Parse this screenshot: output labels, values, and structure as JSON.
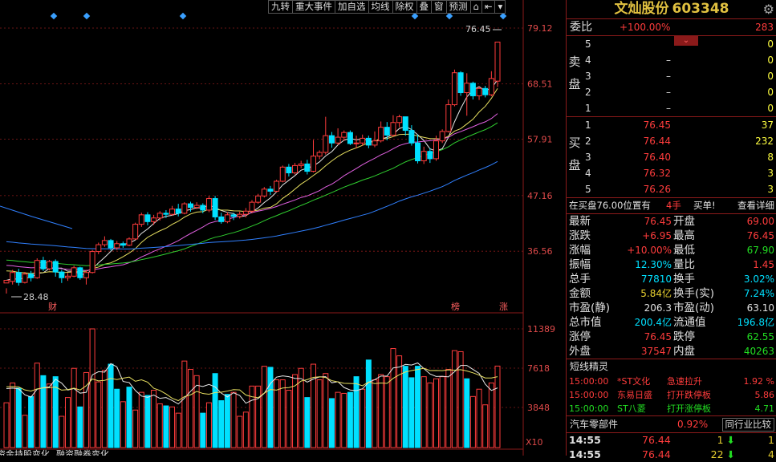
{
  "toolbar": [
    "九转",
    "重大事件",
    "加自选",
    "均线",
    "除权",
    "叠",
    "窗",
    "预测",
    "⇤",
    "▾"
  ],
  "axis": {
    "price_labels": [
      "79.12",
      "68.51",
      "57.91",
      "47.16",
      "36.56"
    ],
    "volume_labels": [
      "11389",
      "7618",
      "3848"
    ],
    "volume_unit": "X10"
  },
  "annotations": {
    "high_label": "76.45",
    "low_label": "28.48",
    "event_left": "财",
    "event_right1": "榜",
    "event_right2": "涨"
  },
  "bottom_tabs": [
    "资金持股变化",
    "融资融券变化"
  ],
  "stock": {
    "name": "文灿股份",
    "code": "603348"
  },
  "weibi": {
    "label": "委比",
    "pct": "+100.00%",
    "val": "283"
  },
  "sell": {
    "label": "卖盘",
    "rows": [
      {
        "n": "5",
        "p": "",
        "v": "0"
      },
      {
        "n": "4",
        "p": "–",
        "v": "0"
      },
      {
        "n": "3",
        "p": "–",
        "v": "0"
      },
      {
        "n": "2",
        "p": "–",
        "v": "0"
      },
      {
        "n": "1",
        "p": "–",
        "v": "0"
      }
    ]
  },
  "buy": {
    "label": "买盘",
    "rows": [
      {
        "n": "1",
        "p": "76.45",
        "v": "37"
      },
      {
        "n": "2",
        "p": "76.44",
        "v": "232"
      },
      {
        "n": "3",
        "p": "76.40",
        "v": "8"
      },
      {
        "n": "4",
        "p": "76.32",
        "v": "3"
      },
      {
        "n": "5",
        "p": "76.26",
        "v": "3"
      }
    ]
  },
  "pos_bar": {
    "text": "在买盘76.00位置有",
    "num": "4手",
    "action": "买单!",
    "detail": "查看详细"
  },
  "quote": [
    [
      "最新",
      "76.45",
      "开盘",
      "69.00"
    ],
    [
      "涨跌",
      "+6.95",
      "最高",
      "76.45"
    ],
    [
      "涨幅",
      "+10.00%",
      "最低",
      "67.90"
    ],
    [
      "振幅",
      "12.30%",
      "量比",
      "1.45"
    ],
    [
      "总手",
      "77810",
      "换手",
      "3.02%"
    ],
    [
      "金额",
      "5.84亿",
      "换手(实)",
      "7.24%"
    ],
    [
      "市盈(静)",
      "206.3",
      "市盈(动)",
      "63.10"
    ],
    [
      "总市值",
      "200.4亿",
      "流通值",
      "196.8亿"
    ],
    [
      "涨停",
      "76.45",
      "跌停",
      "62.55"
    ],
    [
      "外盘",
      "37547",
      "内盘",
      "40263"
    ]
  ],
  "spirit": {
    "title": "短线精灵",
    "rows": [
      [
        "15:00:00",
        "*ST文化",
        "急速拉升",
        "1.92 %"
      ],
      [
        "15:00:00",
        "东易日盛",
        "打开跌停板",
        "5.86"
      ],
      [
        "15:00:00",
        "ST八菱",
        "打开涨停板",
        "4.71"
      ]
    ]
  },
  "sector": {
    "name": "汽车零部件",
    "pct": "0.92%",
    "btn": "同行业比较"
  },
  "ticks": [
    [
      "14:55",
      "76.44",
      "1",
      "1"
    ],
    [
      "14:55",
      "76.44",
      "22",
      "4"
    ]
  ],
  "colors": {
    "up": "#ff3c3c",
    "down": "#00e0ff",
    "bg": "#000000",
    "grid": "#8b1a1a"
  },
  "chart_data": {
    "type": "candlestick",
    "ylim": [
      28.48,
      79.12
    ],
    "candles": [
      [
        30.5,
        31.0,
        29.5,
        28.48
      ],
      [
        30.8,
        32.5,
        30.2,
        33.0
      ],
      [
        32.5,
        30.6,
        30.0,
        33.2
      ],
      [
        30.6,
        32.2,
        30.4,
        32.6
      ],
      [
        32.2,
        31.5,
        30.8,
        32.8
      ],
      [
        31.5,
        34.8,
        31.3,
        35.2
      ],
      [
        34.8,
        33.2,
        32.8,
        35.5
      ],
      [
        33.2,
        34.6,
        32.9,
        34.9
      ],
      [
        34.6,
        32.6,
        31.7,
        35.0
      ],
      [
        32.6,
        31.5,
        30.5,
        33.0
      ],
      [
        31.5,
        31.8,
        30.9,
        32.4
      ],
      [
        31.8,
        33.4,
        31.6,
        33.8
      ],
      [
        33.4,
        31.5,
        31.1,
        33.6
      ],
      [
        31.5,
        32.5,
        30.2,
        33.0
      ],
      [
        32.5,
        36.5,
        32.3,
        36.8
      ],
      [
        36.5,
        37.8,
        36.0,
        38.2
      ],
      [
        37.8,
        38.6,
        37.4,
        39.4
      ],
      [
        38.6,
        37.2,
        36.7,
        38.9
      ],
      [
        37.2,
        38.0,
        36.8,
        38.5
      ],
      [
        38.0,
        37.7,
        37.2,
        38.4
      ],
      [
        37.7,
        38.9,
        37.5,
        39.2
      ],
      [
        38.9,
        41.7,
        38.7,
        42.0
      ],
      [
        41.7,
        43.5,
        41.2,
        43.9
      ],
      [
        43.5,
        42.2,
        41.5,
        44.0
      ],
      [
        42.2,
        42.9,
        41.6,
        43.5
      ],
      [
        42.9,
        43.8,
        42.4,
        44.2
      ],
      [
        43.8,
        43.6,
        42.9,
        44.4
      ],
      [
        43.6,
        44.6,
        43.3,
        45.2
      ],
      [
        44.6,
        43.8,
        43.2,
        45.6
      ],
      [
        43.8,
        45.6,
        43.6,
        45.9
      ],
      [
        45.6,
        44.9,
        44.1,
        46.0
      ],
      [
        44.9,
        45.3,
        44.6,
        45.9
      ],
      [
        45.3,
        44.4,
        43.8,
        45.7
      ],
      [
        44.4,
        46.6,
        44.0,
        47.1
      ],
      [
        46.6,
        43.1,
        42.5,
        47.1
      ],
      [
        43.1,
        42.2,
        41.8,
        43.9
      ],
      [
        42.2,
        43.5,
        41.9,
        44.0
      ],
      [
        43.5,
        43.2,
        42.5,
        43.9
      ],
      [
        43.2,
        43.6,
        42.8,
        44.1
      ],
      [
        43.6,
        44.2,
        43.0,
        44.8
      ],
      [
        44.2,
        45.9,
        43.8,
        46.3
      ],
      [
        45.9,
        47.1,
        45.6,
        47.5
      ],
      [
        47.1,
        48.4,
        46.8,
        48.8
      ],
      [
        48.4,
        48.0,
        47.3,
        49.0
      ],
      [
        48.0,
        49.9,
        47.8,
        50.2
      ],
      [
        49.9,
        52.6,
        49.7,
        52.9
      ],
      [
        52.6,
        51.5,
        50.8,
        53.2
      ],
      [
        51.5,
        52.9,
        51.2,
        53.4
      ],
      [
        52.9,
        53.2,
        52.4,
        53.8
      ],
      [
        53.2,
        51.8,
        51.2,
        54.0
      ],
      [
        51.8,
        54.7,
        51.6,
        57.8
      ],
      [
        54.7,
        55.4,
        54.1,
        55.8
      ],
      [
        55.4,
        58.6,
        55.0,
        62.2
      ],
      [
        58.6,
        57.2,
        56.3,
        59.3
      ],
      [
        57.2,
        58.3,
        56.8,
        60.0
      ],
      [
        58.3,
        59.2,
        57.6,
        59.6
      ],
      [
        59.2,
        57.1,
        56.8,
        59.6
      ],
      [
        57.1,
        57.2,
        56.2,
        58.6
      ],
      [
        57.2,
        58.1,
        56.7,
        58.8
      ],
      [
        58.1,
        56.8,
        56.2,
        58.6
      ],
      [
        56.8,
        57.6,
        56.4,
        59.4
      ],
      [
        57.6,
        60.2,
        57.3,
        61.3
      ],
      [
        60.2,
        58.7,
        57.7,
        61.2
      ],
      [
        58.7,
        61.1,
        58.4,
        62.5
      ],
      [
        61.1,
        62.2,
        60.2,
        62.6
      ],
      [
        62.2,
        59.6,
        58.6,
        61.2
      ],
      [
        59.6,
        57.2,
        56.7,
        60.6
      ],
      [
        57.2,
        53.8,
        53.3,
        58.8
      ],
      [
        53.8,
        55.6,
        53.2,
        56.5
      ],
      [
        55.6,
        54.2,
        53.4,
        56.2
      ],
      [
        54.2,
        57.6,
        53.8,
        58.6
      ],
      [
        57.6,
        59.4,
        57.2,
        59.8
      ],
      [
        59.4,
        64.5,
        59.2,
        65.5
      ],
      [
        64.5,
        70.6,
        64.2,
        71.2
      ],
      [
        70.6,
        66.8,
        66.2,
        70.9
      ],
      [
        66.8,
        68.6,
        62.4,
        70.5
      ],
      [
        68.6,
        66.2,
        65.5,
        68.9
      ],
      [
        66.2,
        67.6,
        65.4,
        68.0
      ],
      [
        67.6,
        66.4,
        65.9,
        68.1
      ],
      [
        66.4,
        69.5,
        66.1,
        70.9
      ],
      [
        69.0,
        76.45,
        67.9,
        76.45
      ]
    ],
    "volume": [
      [
        4300,
        1
      ],
      [
        6200,
        1
      ],
      [
        5700,
        0
      ],
      [
        3100,
        1
      ],
      [
        4900,
        0
      ],
      [
        8100,
        1
      ],
      [
        6900,
        0
      ],
      [
        6100,
        1
      ],
      [
        6800,
        0
      ],
      [
        3000,
        1
      ],
      [
        4800,
        1
      ],
      [
        7600,
        1
      ],
      [
        3900,
        0
      ],
      [
        7200,
        1
      ],
      [
        11389,
        1
      ],
      [
        6300,
        1
      ],
      [
        7400,
        1
      ],
      [
        8000,
        0
      ],
      [
        5600,
        0
      ],
      [
        4400,
        1
      ],
      [
        5800,
        0
      ],
      [
        3600,
        1
      ],
      [
        5300,
        1
      ],
      [
        5000,
        0
      ],
      [
        5500,
        1
      ],
      [
        4200,
        1
      ],
      [
        4000,
        0
      ],
      [
        3900,
        1
      ],
      [
        3300,
        1
      ],
      [
        8300,
        1
      ],
      [
        7500,
        1
      ],
      [
        6900,
        1
      ],
      [
        3300,
        0
      ],
      [
        4300,
        1
      ],
      [
        7100,
        0
      ],
      [
        4500,
        0
      ],
      [
        5100,
        0
      ],
      [
        5300,
        1
      ],
      [
        3000,
        1
      ],
      [
        3400,
        1
      ],
      [
        5900,
        1
      ],
      [
        5900,
        1
      ],
      [
        7800,
        1
      ],
      [
        7700,
        0
      ],
      [
        6500,
        1
      ],
      [
        6500,
        1
      ],
      [
        5500,
        1
      ],
      [
        7000,
        1
      ],
      [
        7600,
        1
      ],
      [
        4800,
        0
      ],
      [
        8000,
        1
      ],
      [
        6500,
        1
      ],
      [
        7100,
        1
      ],
      [
        4700,
        0
      ],
      [
        5300,
        1
      ],
      [
        5200,
        1
      ],
      [
        5300,
        0
      ],
      [
        6800,
        0
      ],
      [
        5600,
        1
      ],
      [
        8400,
        0
      ],
      [
        6500,
        1
      ],
      [
        7000,
        1
      ],
      [
        6800,
        1
      ],
      [
        9500,
        1
      ],
      [
        8800,
        1
      ],
      [
        7800,
        0
      ],
      [
        6700,
        0
      ],
      [
        7800,
        0
      ],
      [
        6800,
        1
      ],
      [
        6200,
        1
      ],
      [
        6600,
        1
      ],
      [
        6800,
        1
      ],
      [
        7500,
        1
      ],
      [
        9300,
        1
      ],
      [
        9200,
        1
      ],
      [
        6600,
        0
      ],
      [
        4900,
        1
      ],
      [
        5600,
        1
      ],
      [
        4100,
        1
      ],
      [
        6200,
        1
      ],
      [
        7818,
        1
      ]
    ]
  }
}
